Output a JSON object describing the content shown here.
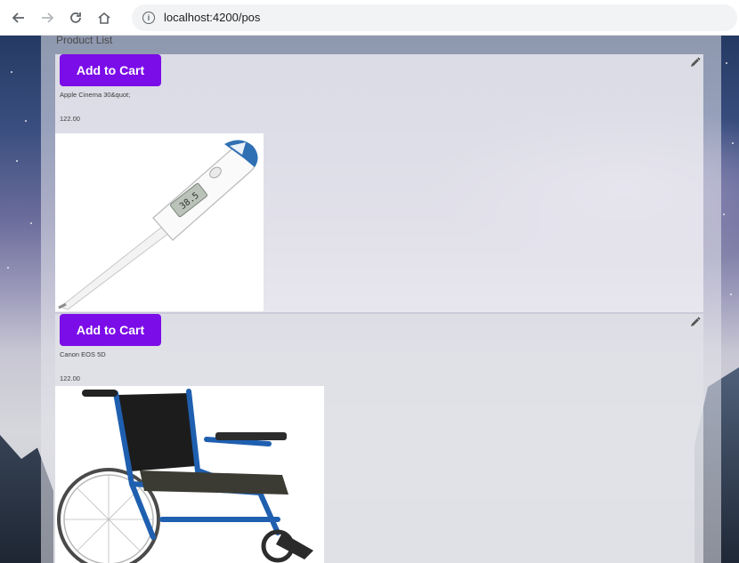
{
  "browser": {
    "url": "localhost:4200/pos"
  },
  "page": {
    "title": "Product List"
  },
  "products": [
    {
      "button_label": "Add to Cart",
      "name": "Apple Cinema 30&quot;",
      "price": "122.00",
      "image_icon": "thermometer-image",
      "thermometer_reading": "38.5"
    },
    {
      "button_label": "Add to Cart",
      "name": "Canon EOS 5D",
      "price": "122.00",
      "image_icon": "wheelchair-image"
    }
  ],
  "colors": {
    "accent": "#7b0de8",
    "thermometer_tip": "#2f6fb3",
    "wheelchair_frame": "#1f5fb0"
  }
}
